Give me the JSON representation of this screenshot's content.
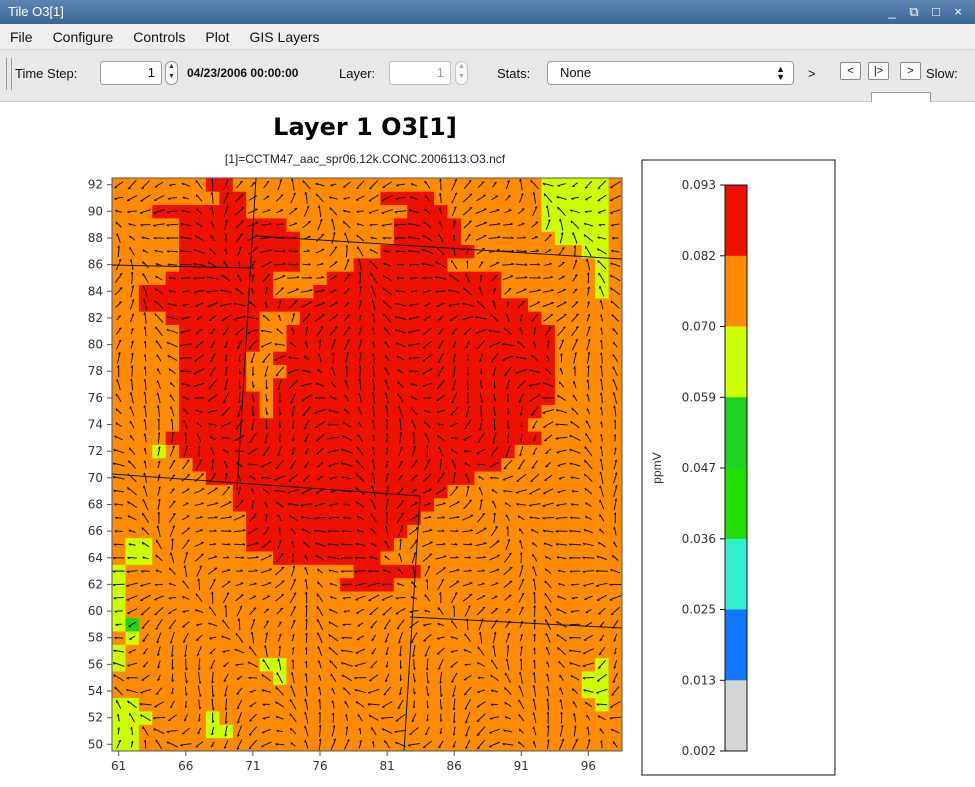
{
  "window": {
    "title": "Tile O3[1]",
    "controls": [
      "_",
      "⧉",
      "□",
      "×"
    ]
  },
  "menu": [
    "File",
    "Configure",
    "Controls",
    "Plot",
    "GIS Layers"
  ],
  "toolbar": {
    "time_step_label": "Time Step:",
    "time_step_value": "1",
    "datetime": "04/23/2006 00:00:00",
    "layer_label": "Layer:",
    "layer_value": "1",
    "stats_label": "Stats:",
    "stats_value": "None",
    "more_glyph": ">",
    "nav_buttons": [
      "<",
      "|>",
      ">"
    ],
    "slow_label": "Slow:"
  },
  "plot": {
    "title": "Layer 1 O3[1]",
    "subtitle": "[1]=CCTM47_aac_spr06.12k.CONC.2006113.O3.ncf",
    "x_ticks": [
      "61",
      "66",
      "71",
      "76",
      "81",
      "86",
      "91",
      "96"
    ],
    "y_ticks": [
      "50",
      "52",
      "54",
      "56",
      "58",
      "60",
      "62",
      "64",
      "66",
      "68",
      "70",
      "72",
      "74",
      "76",
      "78",
      "80",
      "82",
      "84",
      "86",
      "88",
      "90",
      "92"
    ],
    "x_range": [
      61,
      99
    ],
    "y_range": [
      50,
      93
    ]
  },
  "legend": {
    "unit": "ppmV",
    "breaks": [
      "0.093",
      "0.082",
      "0.070",
      "0.059",
      "0.047",
      "0.036",
      "0.025",
      "0.013",
      "0.002"
    ],
    "colors": [
      "#ee1100",
      "#ff8c00",
      "#ccff00",
      "#1fd21f",
      "#22dd00",
      "#33eecc",
      "#1177ff",
      "#d5d5d5"
    ],
    "bins_top_to_bottom": [
      "0.082-0.093",
      "0.070-0.082",
      "0.059-0.070",
      "0.047-0.059",
      "0.036-0.047",
      "0.025-0.036",
      "0.013-0.025",
      "0.002-0.013"
    ]
  },
  "grid": {
    "dominant_level": "0.070-0.082",
    "red_row_spans": [
      [
        [
          68,
          69
        ]
      ],
      [
        [
          69,
          70
        ],
        [
          81,
          84
        ]
      ],
      [
        [
          64,
          70
        ],
        [
          83,
          85
        ]
      ],
      [
        [
          66,
          73
        ],
        [
          82,
          86
        ]
      ],
      [
        [
          66,
          74
        ],
        [
          82,
          86
        ]
      ],
      [
        [
          66,
          74
        ],
        [
          81,
          87
        ]
      ],
      [
        [
          66,
          72
        ],
        [
          73,
          74
        ],
        [
          79,
          85
        ]
      ],
      [
        [
          65,
          72
        ],
        [
          77,
          89
        ]
      ],
      [
        [
          63,
          72
        ],
        [
          76,
          89
        ]
      ],
      [
        [
          63,
          91
        ]
      ],
      [
        [
          65,
          71
        ],
        [
          75,
          92
        ]
      ],
      [
        [
          66,
          71
        ],
        [
          74,
          93
        ]
      ],
      [
        [
          66,
          71
        ],
        [
          74,
          93
        ]
      ],
      [
        [
          66,
          70
        ],
        [
          73,
          93
        ]
      ],
      [
        [
          66,
          70
        ],
        [
          74,
          93
        ]
      ],
      [
        [
          66,
          70
        ],
        [
          73,
          93
        ]
      ],
      [
        [
          66,
          71
        ],
        [
          73,
          93
        ]
      ],
      [
        [
          66,
          71
        ],
        [
          73,
          92
        ]
      ],
      [
        [
          66,
          72
        ],
        [
          73,
          91
        ]
      ],
      [
        [
          65,
          92
        ]
      ],
      [
        [
          66,
          90
        ]
      ],
      [
        [
          67,
          89
        ]
      ],
      [
        [
          68,
          87
        ]
      ],
      [
        [
          70,
          85
        ]
      ],
      [
        [
          70,
          84
        ]
      ],
      [
        [
          71,
          83
        ]
      ],
      [
        [
          71,
          82
        ]
      ],
      [
        [
          71,
          81
        ]
      ],
      [
        [
          73,
          80
        ]
      ],
      [
        [
          79,
          83
        ]
      ],
      [
        [
          78,
          81
        ]
      ]
    ],
    "yellow_cells": [
      [
        93,
        92
      ],
      [
        94,
        92
      ],
      [
        95,
        92
      ],
      [
        96,
        92
      ],
      [
        97,
        92
      ],
      [
        93,
        91
      ],
      [
        94,
        91
      ],
      [
        95,
        91
      ],
      [
        96,
        91
      ],
      [
        97,
        91
      ],
      [
        93,
        90
      ],
      [
        94,
        90
      ],
      [
        95,
        90
      ],
      [
        96,
        90
      ],
      [
        97,
        90
      ],
      [
        93,
        89
      ],
      [
        94,
        89
      ],
      [
        95,
        89
      ],
      [
        96,
        89
      ],
      [
        97,
        89
      ],
      [
        94,
        88
      ],
      [
        95,
        88
      ],
      [
        96,
        88
      ],
      [
        97,
        88
      ],
      [
        96,
        87
      ],
      [
        97,
        87
      ],
      [
        97,
        86
      ],
      [
        97,
        85
      ],
      [
        97,
        84
      ],
      [
        64,
        72
      ],
      [
        62,
        65
      ],
      [
        63,
        65
      ],
      [
        62,
        64
      ],
      [
        63,
        64
      ],
      [
        61,
        63
      ],
      [
        61,
        62
      ],
      [
        61,
        61
      ],
      [
        61,
        60
      ],
      [
        61,
        59
      ],
      [
        62,
        58
      ],
      [
        61,
        57
      ],
      [
        61,
        56
      ],
      [
        97,
        56
      ],
      [
        96,
        55
      ],
      [
        97,
        55
      ],
      [
        96,
        54
      ],
      [
        97,
        54
      ],
      [
        97,
        53
      ],
      [
        72,
        56
      ],
      [
        73,
        56
      ],
      [
        73,
        55
      ],
      [
        61,
        53
      ],
      [
        62,
        53
      ],
      [
        61,
        52
      ],
      [
        62,
        52
      ],
      [
        63,
        52
      ],
      [
        61,
        51
      ],
      [
        62,
        51
      ],
      [
        61,
        50
      ],
      [
        62,
        50
      ],
      [
        68,
        52
      ],
      [
        68,
        51
      ],
      [
        69,
        51
      ]
    ],
    "green_cells": [
      [
        62,
        59
      ]
    ]
  }
}
